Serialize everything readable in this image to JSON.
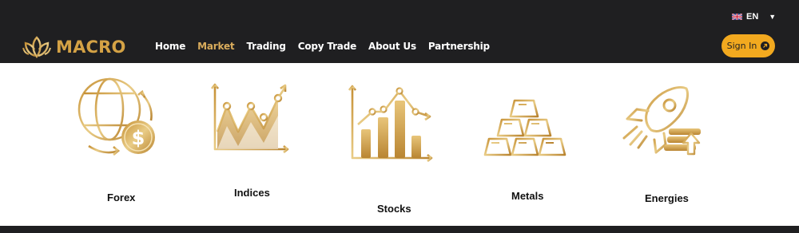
{
  "header": {
    "language": "EN",
    "brand": "MACRO",
    "nav": [
      {
        "label": "Home",
        "active": false
      },
      {
        "label": "Market",
        "active": true
      },
      {
        "label": "Trading",
        "active": false
      },
      {
        "label": "Copy Trade",
        "active": false
      },
      {
        "label": "About Us",
        "active": false
      },
      {
        "label": "Partnership",
        "active": false
      }
    ],
    "sign_in": "Sign In"
  },
  "markets": [
    {
      "label": "Forex",
      "icon": "globe-dollar-icon"
    },
    {
      "label": "Indices",
      "icon": "line-chart-icon"
    },
    {
      "label": "Stocks",
      "icon": "bar-chart-icon"
    },
    {
      "label": "Metals",
      "icon": "gold-bars-icon"
    },
    {
      "label": "Energies",
      "icon": "rocket-coins-icon"
    }
  ],
  "colors": {
    "header_bg": "#1f1f21",
    "gold": "#d4a245",
    "accent_button": "#f2a91f"
  }
}
